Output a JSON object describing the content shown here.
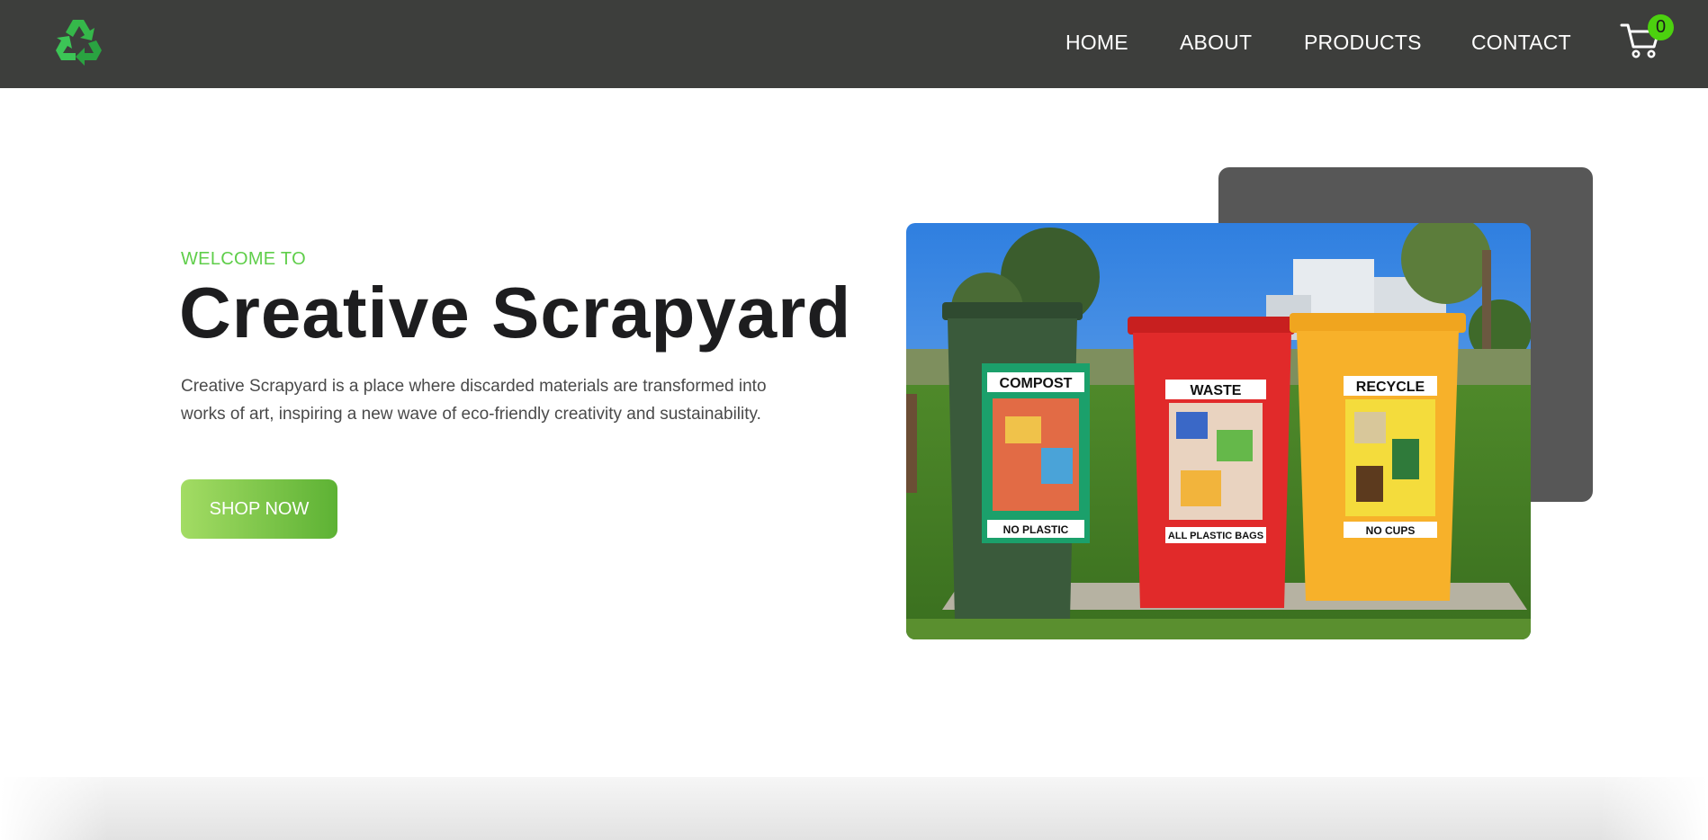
{
  "nav": {
    "logo_icon": "recycle-icon",
    "links": [
      {
        "label": "HOME"
      },
      {
        "label": "ABOUT"
      },
      {
        "label": "PRODUCTS"
      },
      {
        "label": "CONTACT"
      }
    ],
    "cart_icon": "cart-icon",
    "cart_count": "0"
  },
  "hero": {
    "eyebrow": "WELCOME TO",
    "title": "Creative Scrapyard",
    "description": "Creative Scrapyard is a place where discarded materials are transformed into works of art, inspiring a new wave of eco-friendly creativity and sustainability.",
    "cta_label": "SHOP NOW",
    "image": {
      "bins": [
        {
          "top_label": "COMPOST",
          "bottom_label": "NO PLASTIC"
        },
        {
          "top_label": "WASTE",
          "bottom_label": "ALL PLASTIC BAGS"
        },
        {
          "top_label": "RECYCLE",
          "bottom_label": "NO CUPS"
        }
      ]
    }
  },
  "colors": {
    "nav_bg": "#3d3e3c",
    "accent_green": "#5fce4a",
    "badge_green": "#4cd10f",
    "panel_gray": "#575757"
  }
}
